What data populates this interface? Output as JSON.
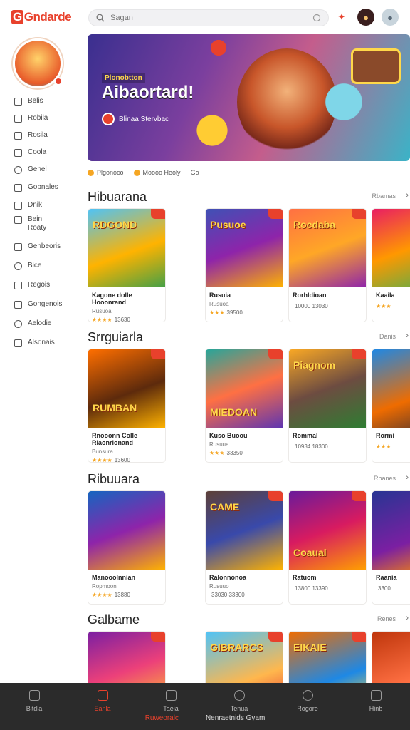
{
  "header": {
    "logo": "Gndarde",
    "search": {
      "placeholder": "Sagan"
    }
  },
  "sidebar": {
    "items": [
      {
        "label": "Belis",
        "icon": "home-icon"
      },
      {
        "label": "Robila",
        "icon": "grid-icon"
      },
      {
        "label": "Rosila",
        "icon": "grid-icon"
      },
      {
        "label": "Coola",
        "icon": "bag-icon"
      },
      {
        "label": "Genel",
        "icon": "user-icon"
      },
      {
        "label": "Gobnales",
        "icon": "grid-icon"
      },
      {
        "label": "Dnik",
        "icon": "cart-icon"
      },
      {
        "label": "Bein Roaty",
        "icon": "controller-icon"
      },
      {
        "label": "Genbeoris",
        "icon": "grid-icon"
      },
      {
        "label": "Bice",
        "icon": "circle-icon"
      },
      {
        "label": "Regois",
        "icon": "lock-icon"
      },
      {
        "label": "Gongenois",
        "icon": "grid-icon"
      },
      {
        "label": "Aelodie",
        "icon": "clock-icon"
      },
      {
        "label": "Alsonais",
        "icon": "grid-icon"
      }
    ]
  },
  "hero": {
    "tag": "Plonobtton",
    "title": "Aibaortard!",
    "subtitle": "Blinaa Stervbac"
  },
  "filters": [
    {
      "label": "Plgonoco"
    },
    {
      "label": "Moooo Heoly"
    },
    {
      "label": "Go"
    }
  ],
  "sections": [
    {
      "title": "Hibuarana",
      "more": "Rbamas",
      "cards": [
        {
          "title": "RDGOND",
          "name": "Kagone dolle Hooonrand",
          "meta": "Rusuoa",
          "stars": "★★★★",
          "count": "13630"
        },
        {
          "title": "Pusuoe",
          "name": "Rusuia",
          "meta": "Rusuoa",
          "stars": "★★★",
          "count": "39500"
        },
        {
          "title": "Rocdaba",
          "name": "Rorhldioan",
          "meta": "",
          "stars": "",
          "count": "10000 13030"
        },
        {
          "title": "",
          "name": "Kaaila",
          "meta": "",
          "stars": "★★★",
          "count": ""
        }
      ]
    },
    {
      "title": "Srrguiarla",
      "more": "Danis",
      "cards": [
        {
          "title": "RUMBAN",
          "name": "Rnooonn Colle Rlaonrlonand",
          "meta": "Bunsura",
          "stars": "★★★★",
          "count": "13600"
        },
        {
          "title": "MIEDOAN",
          "name": "Kuso Buoou",
          "meta": "Rusuua",
          "stars": "★★★",
          "count": "33350"
        },
        {
          "title": "Piagnom",
          "name": "Rommal",
          "meta": "",
          "stars": "",
          "count": "10934 18300"
        },
        {
          "title": "",
          "name": "Rormi",
          "meta": "",
          "stars": "★★★",
          "count": ""
        }
      ]
    },
    {
      "title": "Ribuuara",
      "more": "Rbanes",
      "cards": [
        {
          "title": "",
          "name": "Manooolnnian",
          "meta": "Ropmoon",
          "stars": "★★★★",
          "count": "13880"
        },
        {
          "title": "CAME",
          "name": "Ralonnonoa",
          "meta": "Rusuuo",
          "stars": "",
          "count": "33030 33300"
        },
        {
          "title": "Coaual",
          "name": "Ratuom",
          "meta": "",
          "stars": "",
          "count": "13800 13390"
        },
        {
          "title": "",
          "name": "Raania",
          "meta": "",
          "stars": "",
          "count": "3300"
        }
      ]
    },
    {
      "title": "Galbame",
      "more": "Renes",
      "cards": [
        {
          "title": "",
          "name": "",
          "meta": "",
          "stars": "",
          "count": ""
        },
        {
          "title": "GIBRARCS",
          "name": "",
          "meta": "",
          "stars": "",
          "count": ""
        },
        {
          "title": "EIKAIE",
          "name": "",
          "meta": "",
          "stars": "",
          "count": ""
        },
        {
          "title": "",
          "name": "",
          "meta": "",
          "stars": "",
          "count": ""
        }
      ]
    }
  ],
  "bottomnav": {
    "items": [
      {
        "label": "Bitdla",
        "icon": "grid-icon"
      },
      {
        "label": "Eanla",
        "icon": "home-icon"
      },
      {
        "label": "Taeia",
        "icon": "t-icon"
      },
      {
        "label": "Tenua",
        "icon": "gear-icon"
      },
      {
        "label": "Rogore",
        "icon": "circle-icon"
      },
      {
        "label": "Hinb",
        "icon": "chat-icon"
      }
    ],
    "footer_active": "Ruweoralc",
    "footer_text": "Nenraetnids Gyam"
  },
  "colors": {
    "accent": "#e8412c",
    "star": "#f5a623",
    "nav_bg": "#2b2b2b"
  }
}
